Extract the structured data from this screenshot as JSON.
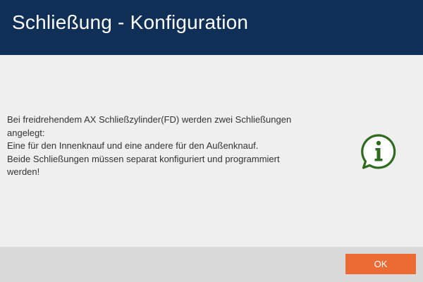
{
  "dialog": {
    "title": "Schließung - Konfiguration",
    "message_lines": [
      "Bei freidrehendem AX Schließzylinder(FD) werden zwei Schließungen",
      "angelegt:",
      "Eine für den Innenknauf und eine andere für den Außenknauf.",
      "Beide Schließungen müssen separat konfiguriert und programmiert",
      "werden!"
    ],
    "icon": "info-speech-bubble-icon",
    "ok_label": "OK"
  },
  "colors": {
    "header_bg": "#0f2f57",
    "body_bg": "#efefef",
    "footer_bg": "#dadada",
    "accent_button": "#ec6b35",
    "icon_green": "#2e6b1e"
  }
}
